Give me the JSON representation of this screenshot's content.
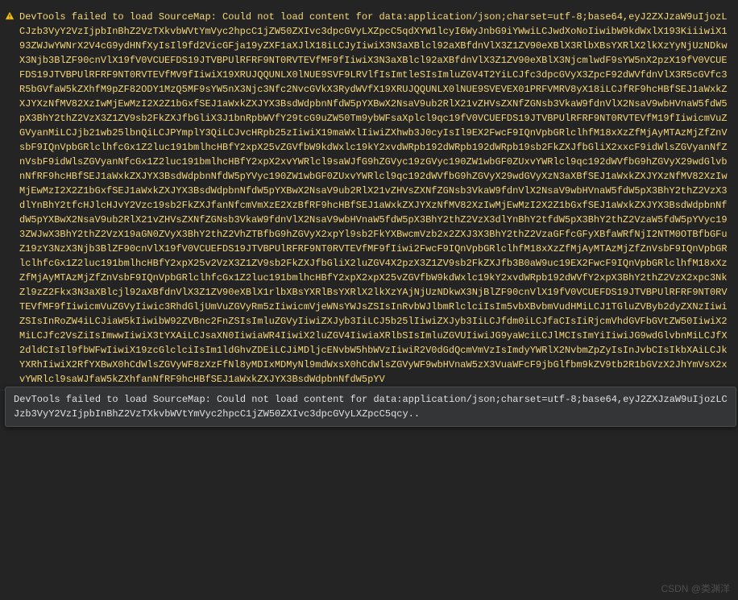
{
  "console": {
    "warning": {
      "icon": "warning-icon",
      "prefix": "DevTools failed to load SourceMap: Could not load content for data:application/json;charset=utf-8;base64,",
      "base64": "eyJ2ZXJzaW9uIjozLCJzb3VyY2VzIjpbInBhZ2VzTXkvbWVtYmVyc2hpcC1jZW50ZXIvc3dpcGVyLXZpcC5qdXYW1lcyI6WyJnbG9iYWwiLCJwdXoNoIiwibW9kdWxlX193KiiiwiX193ZWJwYWNrX2V4cG9ydHNfXyIsIl9fd2VicGFja19yZXF1aXJlX18iLCJyIiwiX3N3aXBlcl92aXBfdnVlX3Z1ZV90eXBlX3RlbXBsYXRlX2lkXzYyNjUzNDkwX3Njb3BlZF90cnVlX19fV0VCUEFDS19JTVBPUlRFRF9NT0RVTEVfMF9fIiwiX3N3aXBlcl92aXBfdnVlX3Z1ZV90eXBlX3NjcmlwdF9sYW5nX2pzX19fV0VCUEFDS19JTVBPUlRFRF9NT0RVTEVfMV9fIiwiX19XRUJQQUNLX0lNUE9SVF9LRVlfIsImtleSIsImluZGV4T2YiLCJfc3dpcGVyX3ZpcF92dWVfdnVlX3R5cGVfc3R5bGVfaW5kZXhfM9pZF82ODY1MzQ5MF9sYW5nX3Njc3Nfc2NvcGVkX3RydWVfX19XRUJQQUNLX0lNUE9SVEVEX01PRFVMRV8yX18iLCJfRF9hcHBfSEJ1aWxkZXJYXzNfMV82XzIwMjEwMzI2X2Z1bGxfSEJ1aWxkZXJYX3BsdWdpbnNfdW5pYXBwX2NsaV9ub2RlX21vZHVsZXNfZGNsb3VkaW9fdnVlX2NsaV9wbHVnaW5fdW5pX3BhY2thZ2VzX3Z1ZV9sb2FkZXJfbGliX3J1bnRpbWVfY29tcG9uZW50Tm9ybWFsaXplcl9qc19fV0VCUEFDS19JTVBPUlRFRF9NT0RVTEVfM19fIiwicmVuZGVyanMiLCJjb21wb25lbnQiLCJPYmplY3QiLCJvcHRpb25zIiwiX19maWxlIiwiZXhwb3J0cyIsIl9EX2FwcF9IQnVpbGRlclhfM18xXzZfMjAyMTAzMjZfZnVsbF9IQnVpbGRlclhfcGx1Z2luc191bmlhcHBfY2xpX25vZGVfbW9kdWxlc19kY2xvdWRpb192dWRpb192dWRpb19sb2FkZXJfbGliX2xxcF9idWlsZGVyanNfZnVsbF9idWlsZGVyanNfcGx1Z2luc191bmlhcHBfY2xpX2xvYWRlcl9saWJfG9hZGVyc19zGVyc190ZW1wbGF0ZUxvYWRlcl9qc192dWVfbG9hZGVyX29wdGlvbnNfRF9hcHBfSEJ1aWxkZXJYX3BsdWdpbnNfdW5pYVyc190ZW1wbGF0ZUxvYWRlcl9qc192dWVfbG9hZGVyX29wdGVyXzN3aXBfSEJ1aWxkZXJYXzNfMV82XzIwMjEwMzI2X2Z1bGxfSEJ1aWxkZXJYX3BsdWdpbnNfdW5pYXBwX2NsaV9ub2RlX21vZHVsZXNfZGNsb3VkaW9fdnVlX2NsaV9wbHVnaW5fdW5pX3BhY2thZ2VzX3dlYnBhY2tfcHJlcHJvY2Vzc19sb2FkZXJfanNfcmVmXzE2XzBfRF9hcHBfSEJ1aWxkZXJYXzNfMV82XzIwMjEwMzI2X2Z1bGxfSEJ1aWxkZXJYX3BsdWdpbnNfdW5pYXBwX2NsaV9ub2RlX21vZHVsZXNfZGNsb3VkaW9fdnVlX2NsaV9wbHVnaW5fdW5pX3BhY2thZ2VzX3dlYnBhY2tfdW5pX3BhY2thZ2VzaW5fdW5pYVyc193ZWJwX3BhY2thZ2VzX19aGN0ZVyX3BhY2thZ2VhZTBfbG9hZGVyX2xpYl9sb2FkYXBwcmVzb2x2ZXJ3X3BhY2thZ2VzaGFfcGFyXBfaWRfNjI2NTM0OTBfbGFuZ19zY3NzX3Njb3BlZF90cnVlX19fV0VCUEFDS19JTVBPUlRFRF9NT0RVTEVfMF9fIiwi2FwcF9IQnVpbGRlclhfM18xXzZfMjAyMTAzMjZfZnVsbF9IQnVpbGRlclhfcGx1Z2luc191bmlhcHBfY2xpX25v2VzX3Z1ZV9sb2FkZXJfbGliX2luZGV4X2pzX3Z1ZV9sb2FkZXJfb3B0aW9uc19EX2FwcF9IQnVpbGRlclhfM18xXzZfMjAyMTAzMjZfZnVsbF9IQnVpbGRlclhfcGx1Z2luc191bmlhcHBfY2xpX2xpX25vZGVfbW9kdWxlc19kY2xvdWRpb192dWVfY2xpX3BhY2thZ2VzX2xpc3NkZl9zZ2Fkx3N3aXBlcjl92aXBfdnVlX3Z1ZV90eXBlX1rlbXBsYXRlBsYXRlX2lkXzYAjNjUzNDkwX3NjBlZF90cnVlX19fV0VCUEFDS19JTVBPUlRFRF9NT0RVTEVfMF9fIiwicmVuZGVyIiwic3RhdGljUmVuZGVyRm5zIiwicmVjeWNsYWJsZSIsInRvbWJlbmRlclciIsIm5vbXBvbmVudHMiLCJ1TGluZVByb2dyZXNzIiwiZSIsInRoZW4iLCJiaW5kIiwibW92ZVBnc2FnZSIsImluZGVyIiwiZXJyb3IiLCJ5b25lIiwiZXJyb3IiLCJfdm0iLCJfaCIsIiRjcmVhdGVFbGVtZW50IiwiX2MiLCJfc2VsZiIsImwwIiwiX3tYXAiLCJsaXN0IiwiaWR4IiwiX2luZGV4IiwiaXRlbSIsImluZGVUIiwiJG9yaWciLCJlMCIsImYiIiwiJG9wdGlvbnMiLCJfX2dldCIsIl9fbWFwIiwiX19zcGlclciIsIm1ldGhvZDEiLCJiMDljcENvbW5hbWVzIiwiR2V0dGdQcmVmVzIsImdyYWRlX2NvbmZpZyIsInJvbCIsIkbXAiLCJkYXRhIiwiX2RfYXBwX0hCdWlsZGVyWF8zXzFfNl8yMDIxMDMyNl9mdWxsX0hCdWlsZGVyWF9wbHVnaW5zX3VuaWFcF9jbGlfbm9kZV9tb2R1bGVzX2JhYmVsX2xvYWRlcl9saWJfaW5kZXhfanNfRF9hcHBfSEJ1aWxkZXJYX3BsdWdpbnNfdW5pYV"
    }
  },
  "tooltip": {
    "text": "DevTools failed to load SourceMap: Could not load content for data:application/json;charset=utf-8;base64,eyJ2ZXJzaW9uIjozLCJzb3VyY2VzIjpbInBhZ2VzTXkvbWVtYmVyc2hpcC1jZW50ZXIvc3dpcGVyLXZpcC5qcy.."
  },
  "watermark": "CSDN @类渊洋"
}
